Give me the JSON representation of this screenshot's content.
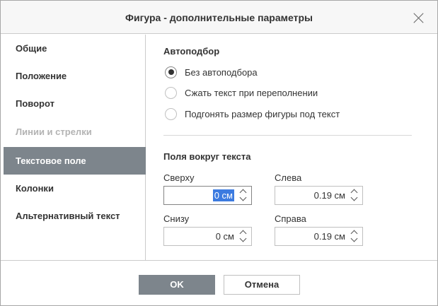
{
  "dialog": {
    "title": "Фигура - дополнительные параметры"
  },
  "sidebar": {
    "items": [
      {
        "label": "Общие",
        "state": "normal"
      },
      {
        "label": "Положение",
        "state": "normal"
      },
      {
        "label": "Поворот",
        "state": "normal"
      },
      {
        "label": "Линии и стрелки",
        "state": "disabled"
      },
      {
        "label": "Текстовое поле",
        "state": "active"
      },
      {
        "label": "Колонки",
        "state": "normal"
      },
      {
        "label": "Альтернативный текст",
        "state": "normal"
      }
    ]
  },
  "autofit": {
    "title": "Автоподбор",
    "options": [
      {
        "label": "Без автоподбора",
        "checked": true
      },
      {
        "label": "Сжать текст при переполнении",
        "checked": false
      },
      {
        "label": "Подгонять размер фигуры под текст",
        "checked": false
      }
    ]
  },
  "margins": {
    "title": "Поля вокруг текста",
    "top": {
      "label": "Сверху",
      "value": "0 см"
    },
    "left": {
      "label": "Слева",
      "value": "0.19 см"
    },
    "bottom": {
      "label": "Снизу",
      "value": "0 см"
    },
    "right": {
      "label": "Справа",
      "value": "0.19 см"
    }
  },
  "footer": {
    "ok_label": "OK",
    "cancel_label": "Отмена"
  },
  "colors": {
    "active_bg": "#7d858c",
    "selection": "#3c7be0",
    "border": "#cbcbcb"
  }
}
